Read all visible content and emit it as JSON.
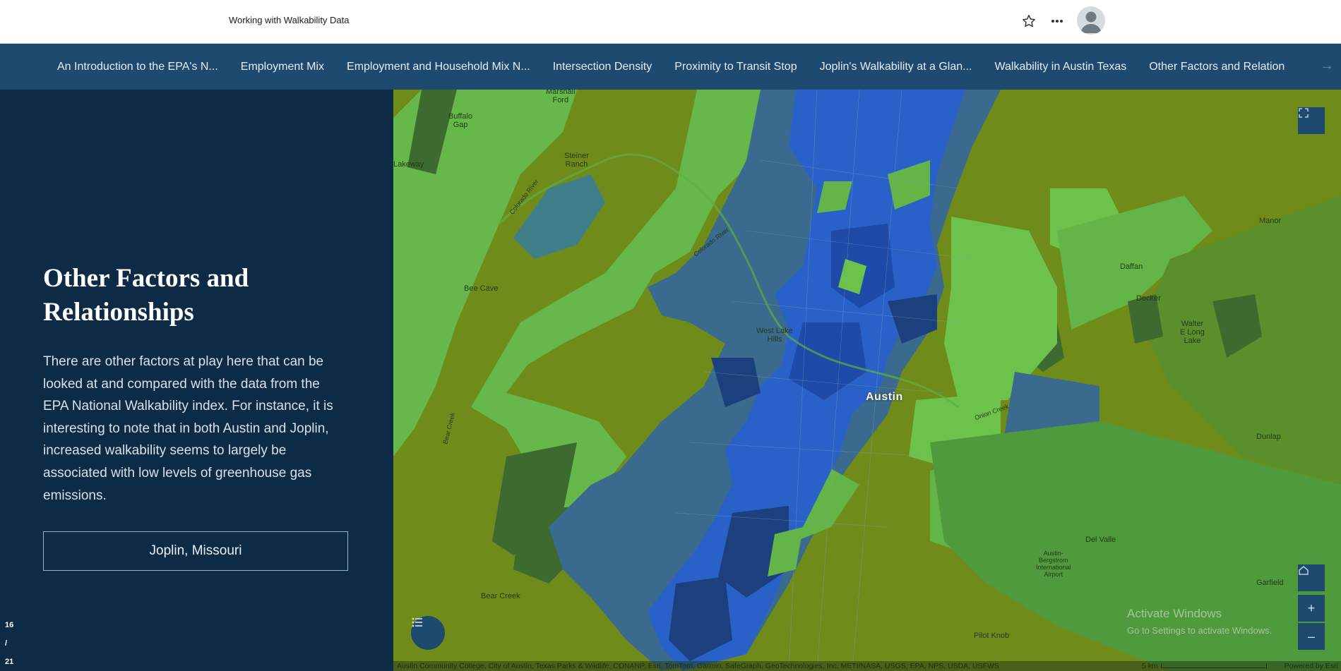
{
  "header": {
    "title": "Working with Walkability Data"
  },
  "nav": {
    "tabs": [
      {
        "label": "An Introduction to the EPA's N..."
      },
      {
        "label": "Employment Mix"
      },
      {
        "label": "Employment and Household Mix N..."
      },
      {
        "label": "Intersection Density"
      },
      {
        "label": "Proximity to Transit Stop"
      },
      {
        "label": "Joplin's Walkability at a Glan..."
      },
      {
        "label": "Walkability in Austin Texas"
      },
      {
        "label": "Other Factors and Relationships"
      }
    ],
    "next_arrow": "→"
  },
  "panel": {
    "heading": "Other Factors and Relationships",
    "body": "There are other factors at play here that can be looked at and compared with the data from the EPA National Walkability index. For instance, it is interesting to note that in both Austin and Joplin, increased walkability seems to largely be associated with low levels of greenhouse gas emissions.",
    "button_label": "Joplin, Missouri",
    "counter_current": "16",
    "counter_sep": "/",
    "counter_total": "21"
  },
  "map": {
    "city": "Austin",
    "labels": {
      "marshall_ford": "Marshall\nFord",
      "buffalo_gap": "Buffalo\nGap",
      "steiner_ranch": "Steiner\nRanch",
      "lakeway": "Lakeway",
      "bee_cave": "Bee Cave",
      "west_lake_hills": "West Lake\nHills",
      "manor": "Manor",
      "daffan": "Daffan",
      "decker": "Decker",
      "walter_e_long_lake": "Walter\nE Long\nLake",
      "dunlap": "Dunlap",
      "del_valle": "Del Valle",
      "airport": "Austin-\nBergstrom\nInternational\nAirport",
      "garfield": "Garfield",
      "bear_creek": "Bear Creek",
      "pilot_knob": "Pilot Knob",
      "colorado_river_1": "Colorado River",
      "colorado_river_2": "Colorado River",
      "onion_creek": "Onion Creek",
      "bear_creek_stream": "Bear Creek"
    },
    "attribution": "Austin Community College, City of Austin, Texas Parks & Wildlife, CONANP, Esri, TomTom, Garmin, SafeGraph, GeoTechnologies, Inc, METI/NASA, USGS, EPA, NPS, USDA, USFWS",
    "scale_label": "5 km",
    "powered_by": "Powered by Esri",
    "watermark_title": "Activate Windows",
    "watermark_sub": "Go to Settings to activate Windows.",
    "zoom_in": "+",
    "zoom_out": "–",
    "colors": {
      "base": "#6f8c1b",
      "light_green": "#6cc24a",
      "mid_green": "#4f9a3c",
      "dark_green": "#3d6a2e",
      "teal": "#3f7f8a",
      "slate": "#3a6a8e",
      "blue": "#2a61c9",
      "deep_blue": "#1e4aa8",
      "navy": "#1c3f7e"
    }
  }
}
